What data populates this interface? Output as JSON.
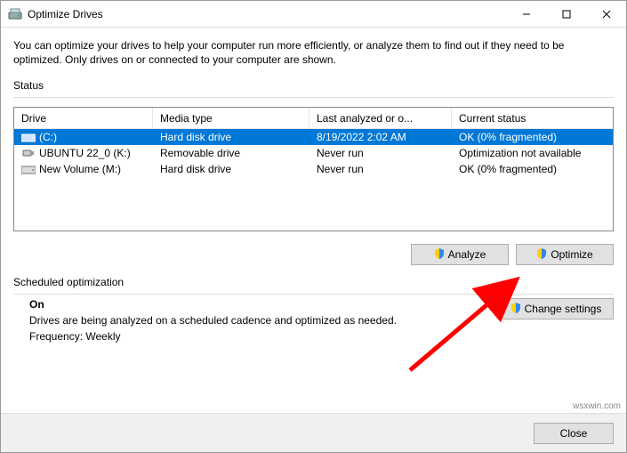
{
  "window": {
    "title": "Optimize Drives"
  },
  "intro": "You can optimize your drives to help your computer run more efficiently, or analyze them to find out if they need to be optimized. Only drives on or connected to your computer are shown.",
  "status_label": "Status",
  "columns": {
    "drive": "Drive",
    "media": "Media type",
    "last": "Last analyzed or o...",
    "status": "Current status"
  },
  "drives": [
    {
      "name": "(C:)",
      "media": "Hard disk drive",
      "last": "8/19/2022 2:02 AM",
      "status": "OK (0% fragmented)",
      "icon": "hdd",
      "selected": true
    },
    {
      "name": "UBUNTU 22_0 (K:)",
      "media": "Removable drive",
      "last": "Never run",
      "status": "Optimization not available",
      "icon": "usb",
      "selected": false
    },
    {
      "name": "New Volume (M:)",
      "media": "Hard disk drive",
      "last": "Never run",
      "status": "OK (0% fragmented)",
      "icon": "hdd",
      "selected": false
    }
  ],
  "buttons": {
    "analyze": "Analyze",
    "optimize": "Optimize",
    "change_settings": "Change settings",
    "close": "Close"
  },
  "scheduled": {
    "label": "Scheduled optimization",
    "state": "On",
    "desc": "Drives are being analyzed on a scheduled cadence and optimized as needed.",
    "freq": "Frequency: Weekly"
  },
  "watermark": "wsxwin.com"
}
